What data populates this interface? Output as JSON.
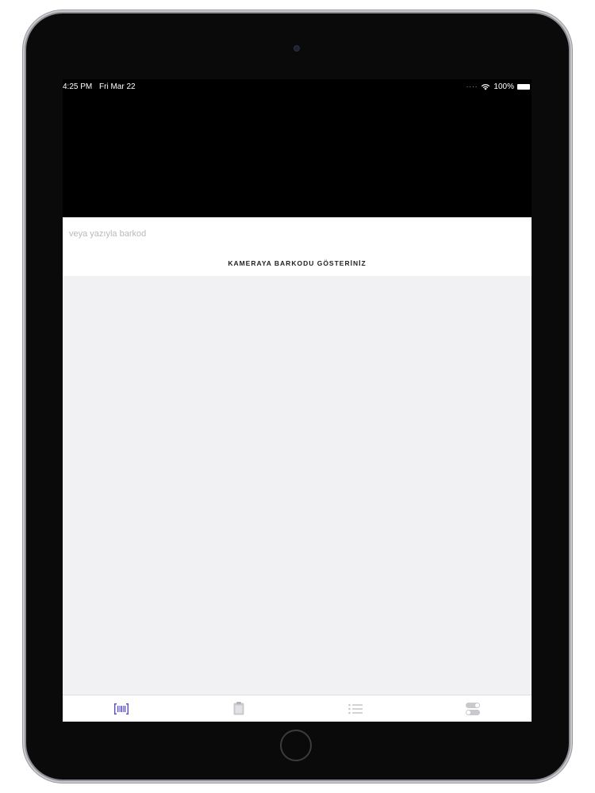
{
  "status_bar": {
    "time": "4:25 PM",
    "date": "Fri Mar 22",
    "battery": "100%"
  },
  "scanner": {
    "input_value": "",
    "input_placeholder": "veya yazıyla barkod",
    "instruction": "KAMERAYA BARKODU GÖSTERİNİZ"
  },
  "tab_bar": {
    "accent_color": "#5b4fc4",
    "inactive_color": "#c8c8cd",
    "tabs": [
      {
        "icon": "barcode-icon",
        "active": true
      },
      {
        "icon": "clipboard-icon",
        "active": false
      },
      {
        "icon": "list-icon",
        "active": false
      },
      {
        "icon": "toggles-icon",
        "active": false
      }
    ]
  }
}
